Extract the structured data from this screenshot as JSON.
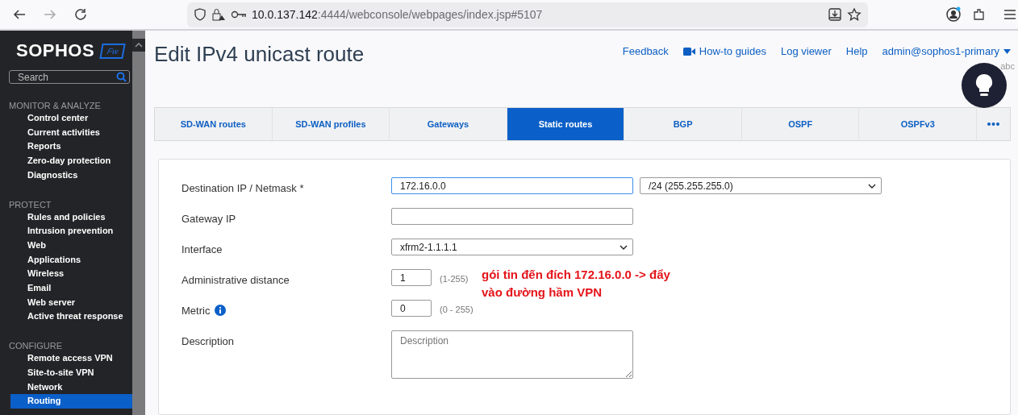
{
  "browser": {
    "url_host": "10.0.137.142",
    "url_path": ":4444/webconsole/webpages/index.jsp#5107"
  },
  "sidebar": {
    "logo": "SOPHOS",
    "badge": "Fw",
    "search": {
      "placeholder": "Search"
    },
    "sections": [
      {
        "title": "MONITOR & ANALYZE",
        "items": [
          {
            "label": "Control center",
            "selected": false
          },
          {
            "label": "Current activities",
            "selected": false
          },
          {
            "label": "Reports",
            "selected": false
          },
          {
            "label": "Zero-day protection",
            "selected": false
          },
          {
            "label": "Diagnostics",
            "selected": false
          }
        ]
      },
      {
        "title": "PROTECT",
        "items": [
          {
            "label": "Rules and policies",
            "selected": false
          },
          {
            "label": "Intrusion prevention",
            "selected": false
          },
          {
            "label": "Web",
            "selected": false
          },
          {
            "label": "Applications",
            "selected": false
          },
          {
            "label": "Wireless",
            "selected": false
          },
          {
            "label": "Email",
            "selected": false
          },
          {
            "label": "Web server",
            "selected": false
          },
          {
            "label": "Active threat response",
            "selected": false
          }
        ]
      },
      {
        "title": "CONFIGURE",
        "items": [
          {
            "label": "Remote access VPN",
            "selected": false
          },
          {
            "label": "Site-to-site VPN",
            "selected": false
          },
          {
            "label": "Network",
            "selected": false
          },
          {
            "label": "Routing",
            "selected": true
          }
        ]
      }
    ]
  },
  "page": {
    "title": "Edit IPv4 unicast route",
    "links": [
      {
        "label": "Feedback",
        "kind": "plain"
      },
      {
        "label": "How-to guides",
        "kind": "video"
      },
      {
        "label": "Log viewer",
        "kind": "plain"
      },
      {
        "label": "Help",
        "kind": "plain"
      },
      {
        "label": "admin@sophos1-primary",
        "kind": "menu"
      }
    ],
    "sub_label": "abc"
  },
  "tabs": [
    {
      "label": "SD-WAN routes",
      "selected": false
    },
    {
      "label": "SD-WAN profiles",
      "selected": false
    },
    {
      "label": "Gateways",
      "selected": false
    },
    {
      "label": "Static routes",
      "selected": true
    },
    {
      "label": "BGP",
      "selected": false
    },
    {
      "label": "OSPF",
      "selected": false
    },
    {
      "label": "OSPFv3",
      "selected": false
    }
  ],
  "form": [
    {
      "kind": "ip_mask",
      "label": "Destination IP / Netmask *",
      "value": "172.16.0.0",
      "select": "/24 (255.255.255.0)"
    },
    {
      "kind": "text",
      "label": "Gateway IP"
    },
    {
      "kind": "select",
      "label": "Interface",
      "value": "xfrm2-1.1.1.1"
    },
    {
      "kind": "number",
      "label": "Administrative distance",
      "value": "1",
      "hint": "(1-255)"
    },
    {
      "kind": "number",
      "label": "Metric",
      "value": "0",
      "hint": "(0 - 255)",
      "info": true
    },
    {
      "kind": "textarea",
      "label": "Description",
      "placeholder": "Description"
    }
  ],
  "annotation": "gói tin đến đích 172.16.0.0 -> đẩy vào đường hầm VPN"
}
